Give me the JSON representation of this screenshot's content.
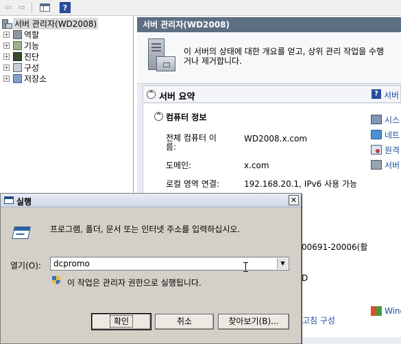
{
  "toolbar": {
    "back_icon": "back-arrow-icon",
    "forward_icon": "forward-arrow-icon",
    "view_icon": "show-hide-console-tree-icon",
    "help_icon": "help-icon",
    "help_glyph": "?"
  },
  "tree": {
    "root_label": "서버 관리자(WD2008)",
    "items": [
      {
        "label": "역할",
        "expander": "+"
      },
      {
        "label": "기능",
        "expander": "+"
      },
      {
        "label": "진단",
        "expander": "+"
      },
      {
        "label": "구성",
        "expander": "+"
      },
      {
        "label": "저장소",
        "expander": "+"
      }
    ]
  },
  "main": {
    "title": "서버 관리자(WD2008)",
    "intro_line1": "이 서버의 상태에 대한 개요를 얻고, 상위 관리 작업을 수행",
    "intro_line2": "거나 제거합니다.",
    "summary": {
      "title": "서버 요약",
      "collapse": "^",
      "help_glyph": "?",
      "help_link": "서버"
    },
    "computer_info": {
      "title": "컴퓨터 정보",
      "collapse": "^",
      "rows": [
        {
          "label_line1": "전체 컴퓨터 이",
          "label_line2": "름:",
          "value": "WD2008.x.com"
        },
        {
          "label": "도메인:",
          "value": "x.com"
        },
        {
          "label": "로컬 영역 연결:",
          "value": "192.168.20.1, IPv6 사용 가능"
        }
      ],
      "partial_value": "00691-20006(활",
      "partial_char": "D"
    },
    "actions": [
      {
        "label": "시스",
        "icon": "system-properties-icon"
      },
      {
        "label": "네트",
        "icon": "network-connections-icon"
      },
      {
        "label": "원격",
        "icon": "remote-desktop-icon"
      },
      {
        "label": "서버",
        "icon": "server-manager-icon"
      }
    ],
    "bottom_action": {
      "label": "Wind",
      "icon": "windows-update-icon"
    },
    "bottom_link": "고침 구성"
  },
  "run_dialog": {
    "title": "실행",
    "close_glyph": "✕",
    "message": "프로그램, 폴더, 문서 또는 인터넷 주소를 입력하십시오.",
    "open_label": "열기(O):",
    "open_value": "dcpromo",
    "dropdown_glyph": "▼",
    "admin_note": "이 작업은 관리자 권한으로 실행됩니다.",
    "buttons": {
      "ok": "확인",
      "cancel": "취소",
      "browse": "찾아보기(B)..."
    }
  }
}
